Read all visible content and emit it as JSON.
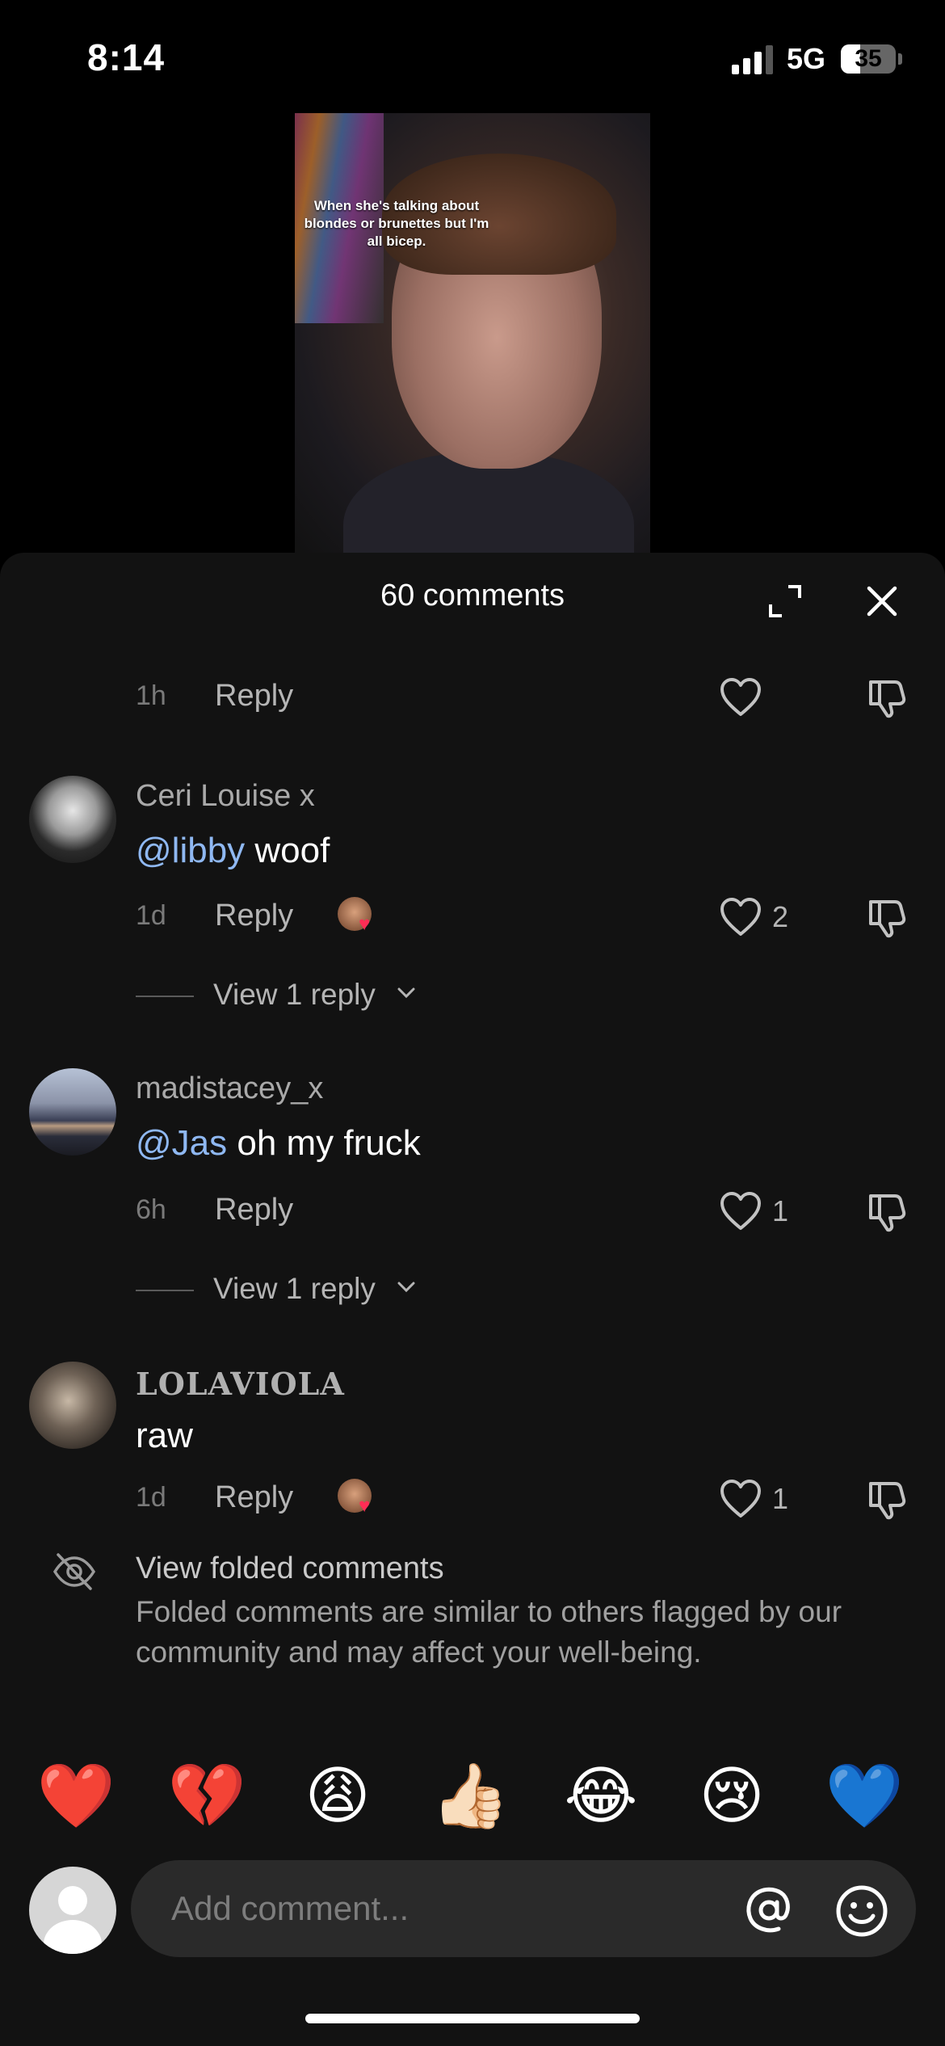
{
  "status": {
    "time": "8:14",
    "network": "5G",
    "battery": "35",
    "battery_level": 0.35
  },
  "video": {
    "caption": "When she's talking about blondes or brunettes but I'm all bicep."
  },
  "sheet": {
    "title": "60 comments"
  },
  "comments": [
    {
      "time": "1h",
      "reply": "Reply"
    },
    {
      "user": "Ceri Louise x",
      "mention": "@libby",
      "text": " woof",
      "time": "1d",
      "reply": "Reply",
      "likes": "2",
      "view_replies": "View 1 reply"
    },
    {
      "user": "madistacey_x",
      "mention": "@Jas",
      "text": " oh my fruck",
      "time": "6h",
      "reply": "Reply",
      "likes": "1",
      "view_replies": "View 1 reply"
    },
    {
      "user": "LOLAVIOLA",
      "text": "raw",
      "time": "1d",
      "reply": "Reply",
      "likes": "1"
    }
  ],
  "folded": {
    "title": "View folded comments",
    "description": "Folded comments are similar to others flagged by our community and may affect your well-being."
  },
  "quick_emojis": [
    "❤️",
    "💔",
    "😩",
    "👍🏻",
    "😂",
    "😢",
    "💙"
  ],
  "composer": {
    "placeholder": "Add comment..."
  },
  "icons": {
    "expand": "expand-icon",
    "close": "close-icon",
    "heart": "heart-outline-icon",
    "dislike": "thumbs-down-icon",
    "eye_off": "eye-off-icon",
    "mention": "at-sign-icon",
    "emoji": "smile-icon"
  },
  "colors": {
    "mention": "#8fb8f2",
    "like_heart": "#ff2d55",
    "sheet_bg": "#121212"
  }
}
